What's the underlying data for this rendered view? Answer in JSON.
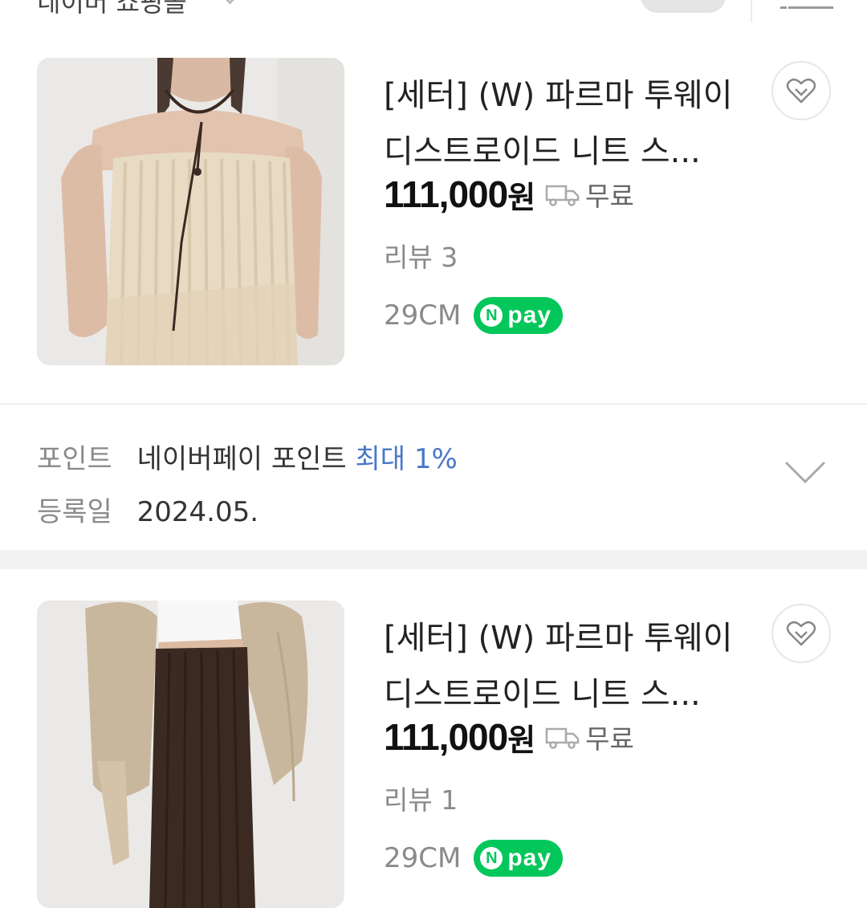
{
  "topbar": {
    "seller": "네이버 쇼핑몰"
  },
  "products": [
    {
      "title_line1": "[세터] (W) 파르마 투웨이",
      "title_line2": "디스트로이드 니트 스...",
      "price": "111,000",
      "currency": "원",
      "shipping": "무료",
      "review": "리뷰 3",
      "store": "29CM",
      "npay_icon": "N",
      "npay_label": "pay"
    },
    {
      "title_line1": "[세터] (W) 파르마 투웨이",
      "title_line2": "디스트로이드 니트 스...",
      "price": "111,000",
      "currency": "원",
      "shipping": "무료",
      "review": "리뷰 1",
      "store": "29CM",
      "npay_icon": "N",
      "npay_label": "pay"
    }
  ],
  "info": {
    "point_label": "포인트",
    "point_text": "네이버페이 포인트",
    "point_highlight": "최대 1%",
    "date_label": "등록일",
    "date_value": "2024.05."
  },
  "icons": {
    "wishlist": "heart-outline-icon",
    "shipping": "truck-icon",
    "expand": "chevron-down-icon",
    "menu": "menu-icon"
  },
  "colors": {
    "npay_green": "#03c75a",
    "highlight_blue": "#4a78c8",
    "muted_text": "#8a8a8a"
  }
}
